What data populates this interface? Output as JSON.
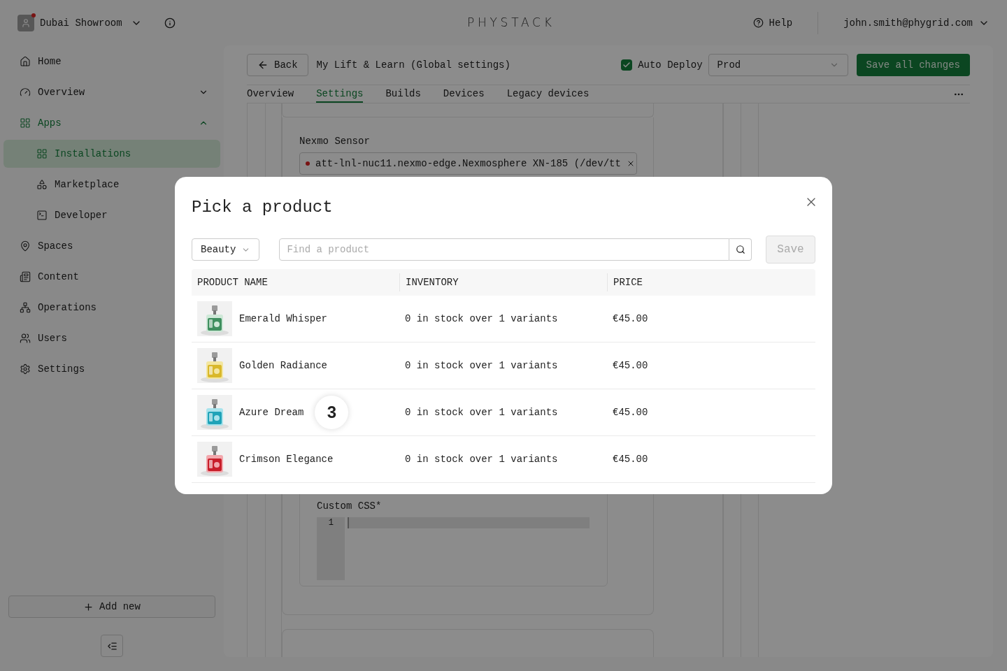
{
  "header": {
    "workspace": "Dubai Showroom",
    "notification": true,
    "logo": "PHYSTACK",
    "help": "Help",
    "user": "john.smith@phygrid.com"
  },
  "sidebar": {
    "items": [
      {
        "label": "Home",
        "selected": false
      },
      {
        "label": "Overview",
        "selected": false,
        "expanded": false
      },
      {
        "label": "Apps",
        "selected": true,
        "expanded": true,
        "children": [
          {
            "label": "Installations",
            "selected": true
          },
          {
            "label": "Marketplace",
            "selected": false
          },
          {
            "label": "Developer",
            "selected": false
          }
        ]
      },
      {
        "label": "Spaces",
        "selected": false
      },
      {
        "label": "Content",
        "selected": false
      },
      {
        "label": "Operations",
        "selected": false
      },
      {
        "label": "Users",
        "selected": false
      },
      {
        "label": "Settings",
        "selected": false
      }
    ],
    "add_button": "Add new"
  },
  "app_header": {
    "back": "Back",
    "title": "My Lift & Learn (Global settings)",
    "auto_deploy": {
      "label": "Auto Deploy",
      "checked": true
    },
    "environment": "Prod",
    "save": "Save all changes"
  },
  "tabs": [
    {
      "label": "Overview",
      "selected": false
    },
    {
      "label": "Settings",
      "selected": true
    },
    {
      "label": "Builds",
      "selected": false
    },
    {
      "label": "Devices",
      "selected": false
    },
    {
      "label": "Legacy devices",
      "selected": false
    }
  ],
  "settings": {
    "sensor_label": "Nexmo Sensor",
    "sensor_value": "att-lnl-nuc11.nexmo-edge.Nexmosphere XN-185 (/dev/tt",
    "custom_css_label": "Custom CSS*",
    "code_lines": [
      "1"
    ]
  },
  "modal": {
    "title": "Pick a product",
    "category": "Beauty",
    "search_placeholder": "Find a product",
    "save": {
      "label": "Save",
      "disabled": true
    },
    "columns": [
      "PRODUCT NAME",
      "INVENTORY",
      "PRICE"
    ],
    "rows": [
      {
        "name": "Emerald Whisper",
        "inventory": "0 in stock over 1 variants",
        "price": "€45.00"
      },
      {
        "name": "Golden Radiance",
        "inventory": "0 in stock over 1 variants",
        "price": "€45.00"
      },
      {
        "name": "Azure Dream",
        "badge": "3",
        "inventory": "0 in stock over 1 variants",
        "price": "€45.00"
      },
      {
        "name": "Crimson Elegance",
        "inventory": "0 in stock over 1 variants",
        "price": "€45.00"
      }
    ]
  }
}
